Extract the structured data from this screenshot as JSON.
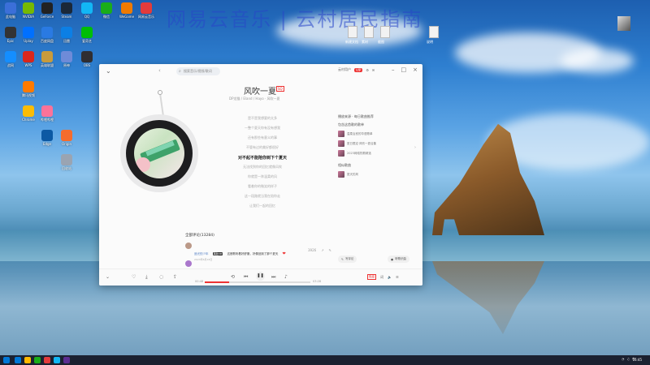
{
  "desktop": {
    "watermark": "网易云音乐 | 云村居民指南",
    "accent": "#e33b3b",
    "icons": [
      {
        "label": "此电脑",
        "color": "#3b6fd8"
      },
      {
        "label": "NVIDIA",
        "color": "#76b900"
      },
      {
        "label": "GeForce",
        "color": "#222"
      },
      {
        "label": "Steam",
        "color": "#1b2838"
      },
      {
        "label": "QQ",
        "color": "#12b7f5"
      },
      {
        "label": "微信",
        "color": "#1aad19"
      },
      {
        "label": "WeGame",
        "color": "#ef7a00"
      },
      {
        "label": "网易云音乐",
        "color": "#e33b3b"
      },
      {
        "label": "Epic",
        "color": "#333"
      },
      {
        "label": "Uplay",
        "color": "#0070ff"
      },
      {
        "label": "百度网盘",
        "color": "#2a7ae2"
      },
      {
        "label": "迅雷",
        "color": "#0c7fe5"
      },
      {
        "label": "爱奇艺",
        "color": "#00be06"
      },
      {
        "label": "腾讯视频",
        "color": "#ff7a00"
      },
      {
        "label": "哔哩哔哩",
        "color": "#fb7299"
      },
      {
        "label": "Origin",
        "color": "#f56c2d"
      },
      {
        "label": "战网",
        "color": "#148eff"
      },
      {
        "label": "WPS",
        "color": "#d9261c"
      },
      {
        "label": "英雄联盟",
        "color": "#c89b3c"
      },
      {
        "label": "原神",
        "color": "#6e8bd8"
      },
      {
        "label": "OBS",
        "color": "#302e31"
      },
      {
        "label": "Chrome",
        "color": "#fbbc05"
      },
      {
        "label": "Edge",
        "color": "#0c59a4"
      },
      {
        "label": "回收站",
        "color": "#9aa4b2"
      }
    ],
    "files": [
      {
        "label": "新建文档"
      },
      {
        "label": "素材"
      },
      {
        "label": "截图"
      },
      {
        "label": "说明"
      }
    ]
  },
  "app": {
    "title": "网易云音乐",
    "search_placeholder": "搜索音乐/视频/歌词",
    "user_label": "云村用户",
    "vip": "VIP",
    "song": {
      "title": "风吹一夏",
      "quality": "SQ",
      "meta": "DP龙猫 / Eland / Hayo · 风吹一夏"
    },
    "lyrics": [
      {
        "text": "是不是我想要的太多"
      },
      {
        "text": "一整个夏天你有没有想我"
      },
      {
        "text": "还有那些有意义的事"
      },
      {
        "text": "不管有过的美好都很好"
      },
      {
        "text": "对不起不能陪你到下个夏天",
        "active": true
      },
      {
        "text": "无法找到你的回忆就像风吹"
      },
      {
        "text": "你就是一阵温柔的风"
      },
      {
        "text": "看着你的微笑的样子"
      },
      {
        "text": "这一段路就当我在陪你走"
      },
      {
        "text": "让我们一起的回忆"
      }
    ],
    "panel": {
      "heading": "播放来源 · 每日歌曲推荐",
      "similar_heading": "包含这首歌的歌单",
      "playlists": [
        {
          "name": "温柔治愈的华语歌单"
        },
        {
          "name": "夏日限定·风吹一夏合集"
        },
        {
          "name": "2023网络热歌精选"
        }
      ],
      "similar_songs_heading": "相似歌曲",
      "similar_songs": [
        {
          "name": "夏天的风"
        }
      ]
    },
    "comments": {
      "heading": "全部评论(13284)",
      "items": [
        {
          "user": "追光的少年",
          "tag": "黑胶VIP",
          "text": "这首歌听着好舒服，好像回到了那个夏天",
          "date": "2023年6月18日",
          "likes": "3926"
        },
        {
          "user": "夏日微风",
          "text": "第一次听就爱上了这首歌，旋律太好听了",
          "date": "2023年7月2日"
        }
      ],
      "write_label": "写评论",
      "floating_label": "听歌识曲"
    },
    "player": {
      "elapsed": "00:48",
      "duration": "03:28",
      "progress": 0.23,
      "quality": "极高",
      "lyric_label": "词"
    }
  },
  "taskbar": {
    "clock": "16:45",
    "tray_lang": "中",
    "apps": [
      {
        "color": "#0078d7"
      },
      {
        "color": "#ffb900"
      },
      {
        "color": "#1aad19"
      },
      {
        "color": "#e33b3b"
      },
      {
        "color": "#12b7f5"
      },
      {
        "color": "#5c2d91"
      }
    ]
  }
}
